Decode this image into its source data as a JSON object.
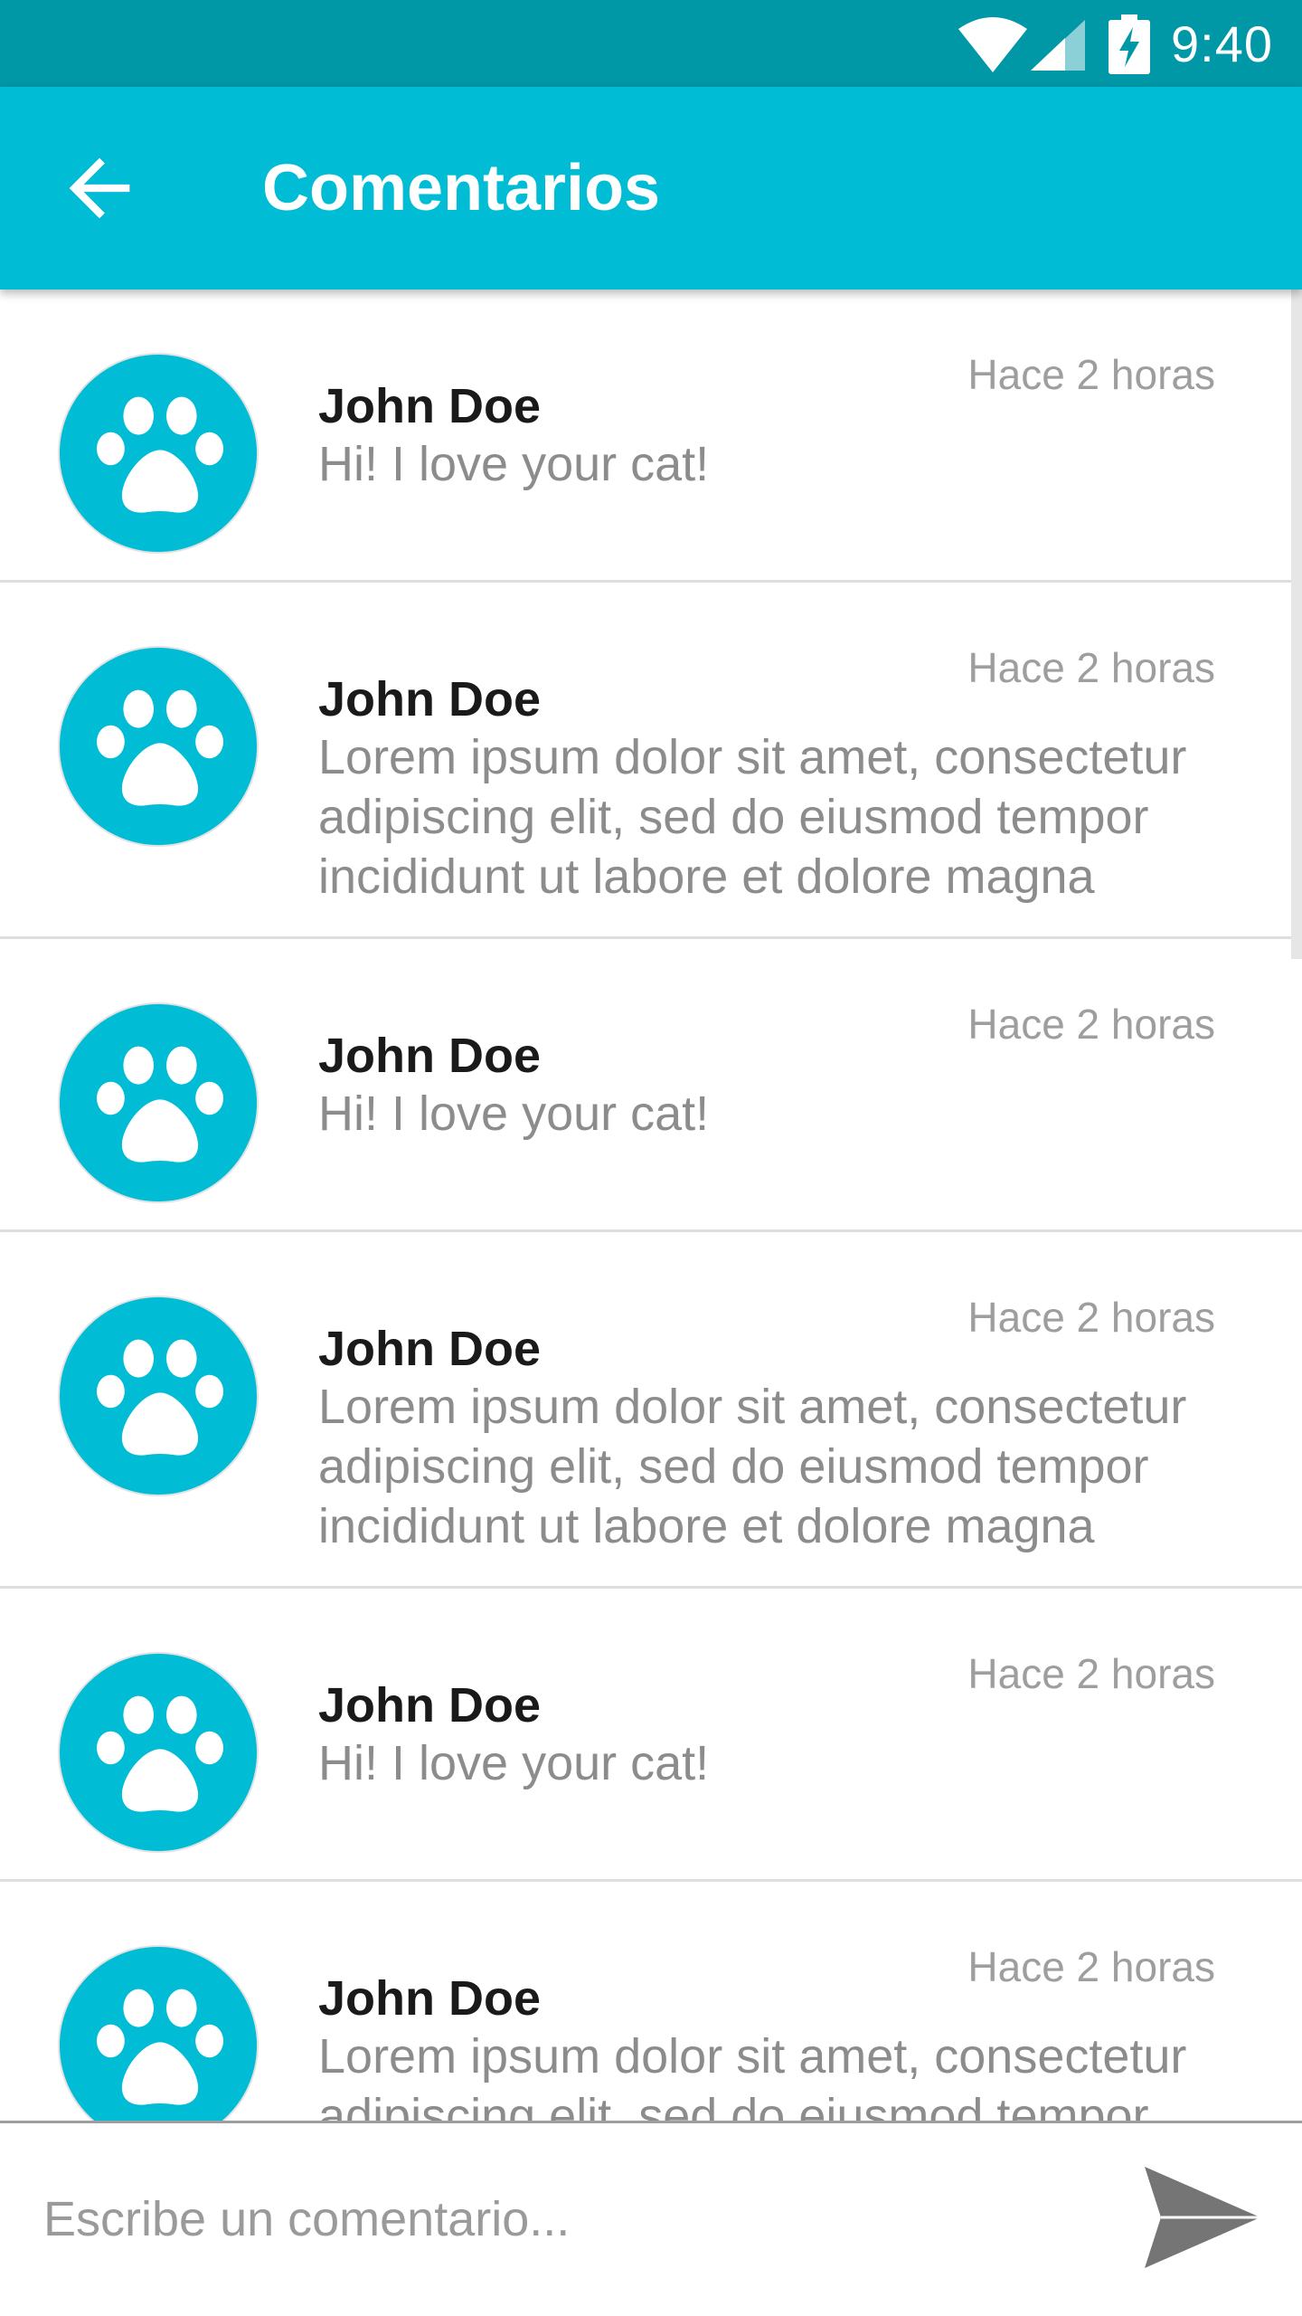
{
  "status_bar": {
    "time": "9:40",
    "icons": [
      "wifi-icon",
      "cell-signal-icon",
      "battery-charging-icon"
    ]
  },
  "app_bar": {
    "title": "Comentarios",
    "back_icon": "arrow-back-icon",
    "background": "#00bcd4"
  },
  "colors": {
    "status_bar": "#0097a7",
    "primary": "#00bcd4",
    "author_text": "#1a1a1a",
    "body_text": "#8c8c8c",
    "time_text": "#9e9e9e"
  },
  "comments": [
    {
      "avatar_icon": "paw-icon",
      "author": "John Doe",
      "time": "Hace 2 horas",
      "text": "Hi! I love your cat!"
    },
    {
      "avatar_icon": "paw-icon",
      "author": "John Doe",
      "time": "Hace 2 horas",
      "text": "Lorem ipsum dolor sit amet, consectetur adipiscing elit, sed do eiusmod tempor incididunt ut labore et dolore magna"
    },
    {
      "avatar_icon": "paw-icon",
      "author": "John Doe",
      "time": "Hace 2 horas",
      "text": "Hi! I love your cat!"
    },
    {
      "avatar_icon": "paw-icon",
      "author": "John Doe",
      "time": "Hace 2 horas",
      "text": "Lorem ipsum dolor sit amet, consectetur adipiscing elit, sed do eiusmod tempor incididunt ut labore et dolore magna"
    },
    {
      "avatar_icon": "paw-icon",
      "author": "John Doe",
      "time": "Hace 2 horas",
      "text": "Hi! I love your cat!"
    },
    {
      "avatar_icon": "paw-icon",
      "author": "John Doe",
      "time": "Hace 2 horas",
      "text": "Lorem ipsum dolor sit amet, consectetur adipiscing elit, sed do eiusmod tempor incididunt ut labore et dolore magna"
    }
  ],
  "input": {
    "value": "",
    "placeholder": "Escribe un comentario...",
    "send_icon": "send-icon"
  }
}
